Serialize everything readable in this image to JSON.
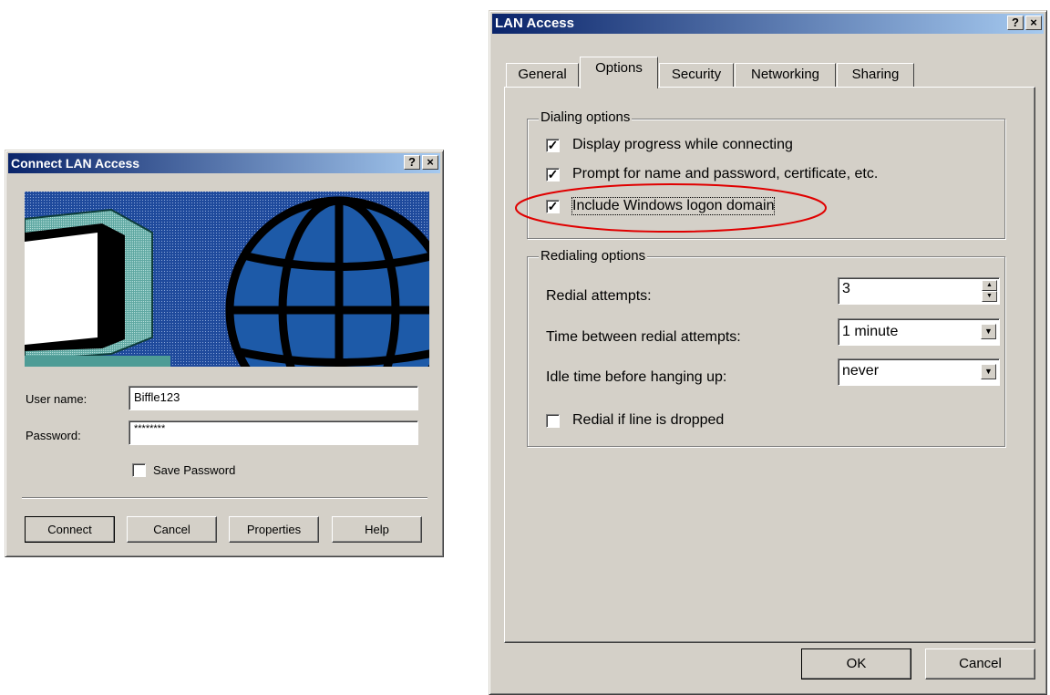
{
  "connect": {
    "title": "Connect LAN Access",
    "help_btn": "?",
    "close_btn": "×",
    "username_label": "User name:",
    "username_value": "Biffle123",
    "password_label": "Password:",
    "password_value": "********",
    "save_password_label": "Save Password",
    "save_password_checked": false,
    "buttons": {
      "connect": "Connect",
      "cancel": "Cancel",
      "properties": "Properties",
      "help": "Help"
    }
  },
  "lan": {
    "title": "LAN Access",
    "help_btn": "?",
    "close_btn": "×",
    "tabs": [
      "General",
      "Options",
      "Security",
      "Networking",
      "Sharing"
    ],
    "active_tab": "Options",
    "dialing": {
      "legend": "Dialing options",
      "options": [
        {
          "label": "Display progress while connecting",
          "checked": true
        },
        {
          "label": "Prompt for name and password, certificate, etc.",
          "checked": true
        },
        {
          "label": "Include Windows logon domain",
          "checked": true
        }
      ]
    },
    "redialing": {
      "legend": "Redialing options",
      "attempts_label": "Redial attempts:",
      "attempts_value": "3",
      "time_label": "Time between redial attempts:",
      "time_value": "1 minute",
      "idle_label": "Idle time before hanging up:",
      "idle_value": "never",
      "redial_dropped_label": "Redial if line is dropped",
      "redial_dropped_checked": false
    },
    "buttons": {
      "ok": "OK",
      "cancel": "Cancel"
    },
    "check_mark": "✓",
    "highlight_color": "#e00000"
  }
}
